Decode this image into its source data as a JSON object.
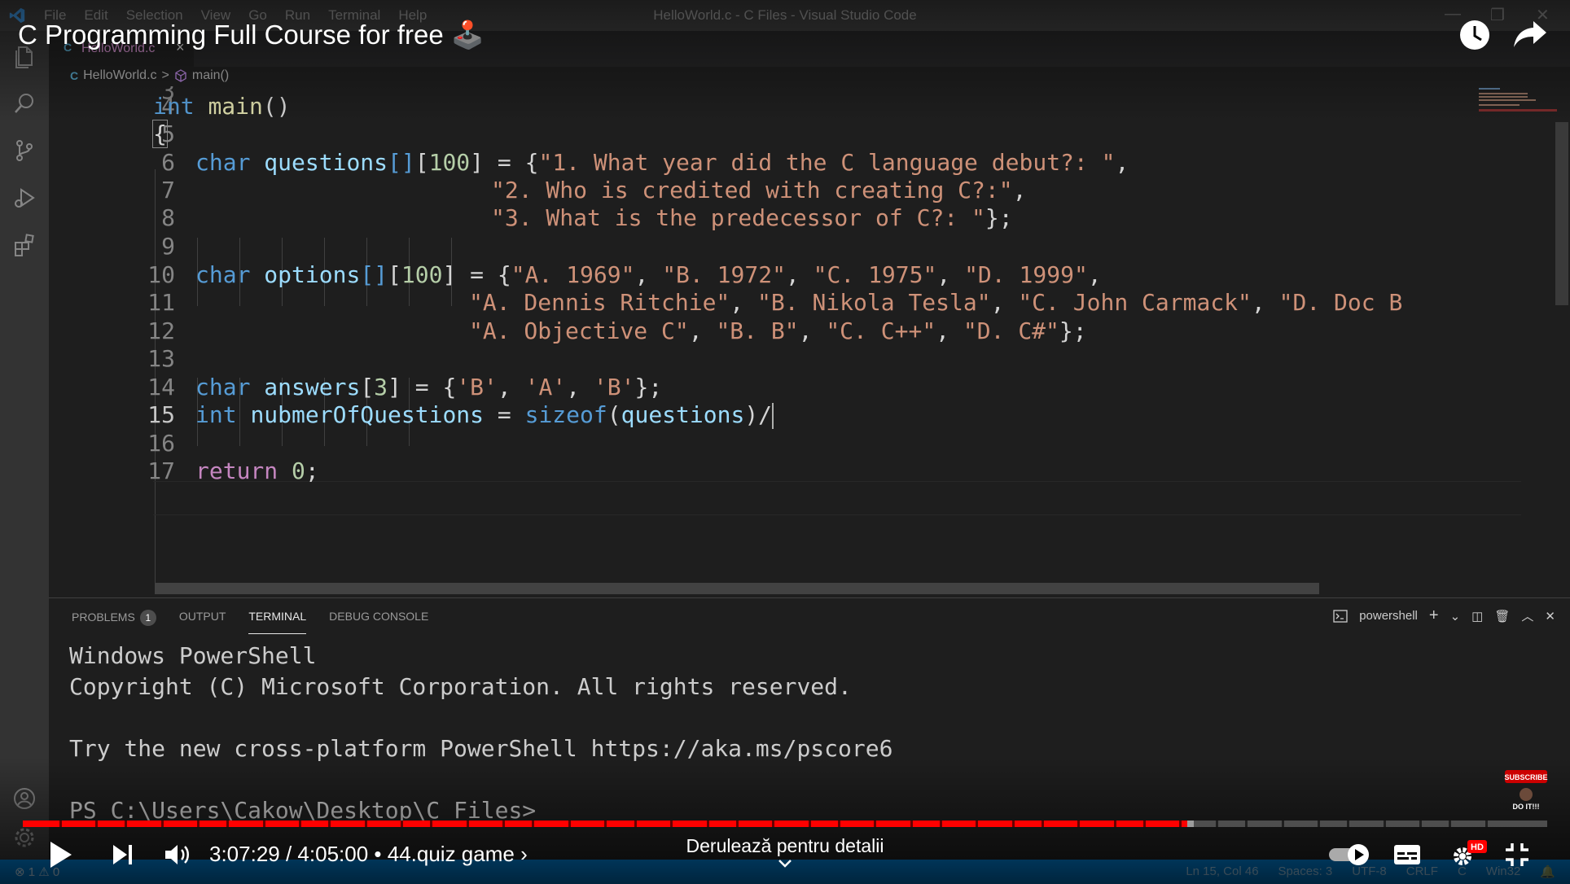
{
  "app": {
    "window_title": "HelloWorld.c - C Files - Visual Studio Code",
    "menu": [
      "File",
      "Edit",
      "Selection",
      "View",
      "Go",
      "Run",
      "Terminal",
      "Help"
    ]
  },
  "editor": {
    "tab_label": "HelloWorld.c",
    "breadcrumb": {
      "lang": "C",
      "file": "HelloWorld.c",
      "separator": ">",
      "symbol": "main()"
    },
    "line_numbers": [
      "3",
      "4",
      "5",
      "6",
      "7",
      "8",
      "9",
      "10",
      "11",
      "12",
      "13",
      "14",
      "15",
      "16",
      "17"
    ],
    "active_line": "15",
    "lines": {
      "l4": {
        "kw": "int",
        "fn": "main",
        "rest": "()"
      },
      "l5": {
        "text": "{"
      },
      "l6": {
        "kw": "char",
        "var": "questions",
        "b1": "[]",
        "b2": "[",
        "num": "100",
        "b3": "] = {",
        "str": "\"1. What year did the C language debut?: \"",
        "end": ","
      },
      "l7": {
        "str": "\"2. Who is credited with creating C?:\"",
        "end": ","
      },
      "l8": {
        "str": "\"3. What is the predecessor of C?: \"",
        "end": "};"
      },
      "l10": {
        "kw": "char",
        "var": "options",
        "b1": "[]",
        "b2": "[",
        "num": "100",
        "b3": "] = {",
        "s1": "\"A. 1969\"",
        "s2": "\"B. 1972\"",
        "s3": "\"C. 1975\"",
        "s4": "\"D. 1999\"",
        "sep": ", ",
        "end": ","
      },
      "l11": {
        "s1": "\"A. Dennis Ritchie\"",
        "s2": "\"B. Nikola Tesla\"",
        "s3": "\"C. John Carmack\"",
        "s4": "\"D. Doc B",
        "sep": ", "
      },
      "l12": {
        "s1": "\"A. Objective C\"",
        "s2": "\"B. B\"",
        "s3": "\"C. C++\"",
        "s4": "\"D. C#\"",
        "sep": ", ",
        "end": "};"
      },
      "l14": {
        "kw": "char",
        "var": "answers",
        "b1": "[",
        "num": "3",
        "b2": "] = {",
        "s1": "'B'",
        "s2": "'A'",
        "s3": "'B'",
        "sep": ", ",
        "end": "};"
      },
      "l15": {
        "kw": "int",
        "var": "nubmerOfQuestions",
        "eq": " = ",
        "fn": "sizeof",
        "p1": "(",
        "arg": "questions",
        "p2": ")/"
      },
      "l17": {
        "ctl": "return",
        "num": "0",
        "end": ";"
      }
    }
  },
  "panel": {
    "tabs": [
      "PROBLEMS",
      "OUTPUT",
      "TERMINAL",
      "DEBUG CONSOLE"
    ],
    "problems_count": "1",
    "active_tab": "TERMINAL",
    "shell": "powershell",
    "terminal_lines": [
      "Windows PowerShell",
      "Copyright (C) Microsoft Corporation. All rights reserved.",
      "",
      "Try the new cross-platform PowerShell https://aka.ms/pscore6",
      "",
      "PS C:\\Users\\Cakow\\Desktop\\C Files>"
    ]
  },
  "statusbar": {
    "errors": "1",
    "warnings": "0",
    "position": "Ln 15, Col 46",
    "spaces": "Spaces: 3",
    "encoding": "UTF-8",
    "eol": "CRLF",
    "language": "C",
    "platform": "Win32"
  },
  "youtube": {
    "title": "C Programming Full Course for free",
    "title_emoji": "🕹️",
    "time_current": "3:07:29",
    "time_total": "4:05:00",
    "chapter": "44.quiz game",
    "scrub_hint": "Derulează pentru detalii",
    "hd_badge": "HD",
    "progress": 0.764,
    "buffered": 0.768,
    "subscribe_text": "SUBSCRIBE",
    "subscribe_sub": "DO IT!!!",
    "colors": {
      "progress": "#ff0000",
      "accent": "#007acc"
    }
  }
}
